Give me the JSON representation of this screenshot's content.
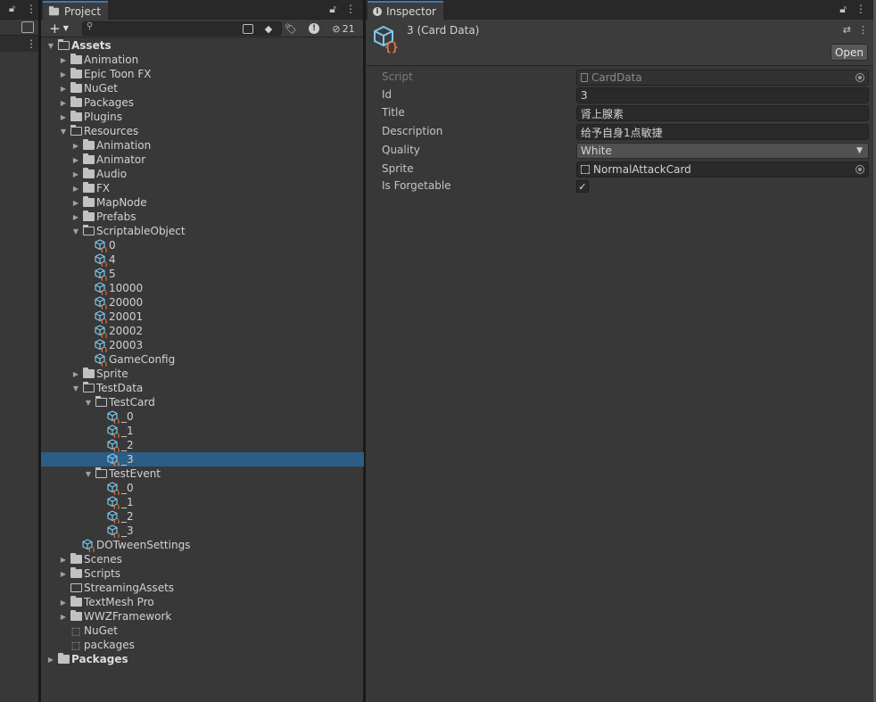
{
  "project": {
    "tab_label": "Project",
    "hidden_count": "21",
    "tree": [
      {
        "label": "Assets",
        "depth": 0,
        "kind": "folder-open",
        "arrow": "down",
        "bold": true
      },
      {
        "label": "Animation",
        "depth": 1,
        "kind": "folder",
        "arrow": "right"
      },
      {
        "label": "Epic Toon FX",
        "depth": 1,
        "kind": "folder",
        "arrow": "right"
      },
      {
        "label": "NuGet",
        "depth": 1,
        "kind": "folder",
        "arrow": "right"
      },
      {
        "label": "Packages",
        "depth": 1,
        "kind": "folder",
        "arrow": "right"
      },
      {
        "label": "Plugins",
        "depth": 1,
        "kind": "folder",
        "arrow": "right"
      },
      {
        "label": "Resources",
        "depth": 1,
        "kind": "folder-open",
        "arrow": "down"
      },
      {
        "label": "Animation",
        "depth": 2,
        "kind": "folder",
        "arrow": "right"
      },
      {
        "label": "Animator",
        "depth": 2,
        "kind": "folder",
        "arrow": "right"
      },
      {
        "label": "Audio",
        "depth": 2,
        "kind": "folder",
        "arrow": "right"
      },
      {
        "label": "FX",
        "depth": 2,
        "kind": "folder",
        "arrow": "right"
      },
      {
        "label": "MapNode",
        "depth": 2,
        "kind": "folder",
        "arrow": "right"
      },
      {
        "label": "Prefabs",
        "depth": 2,
        "kind": "folder",
        "arrow": "right"
      },
      {
        "label": "ScriptableObject",
        "depth": 2,
        "kind": "folder-open",
        "arrow": "down"
      },
      {
        "label": "0",
        "depth": 3,
        "kind": "asset"
      },
      {
        "label": "4",
        "depth": 3,
        "kind": "asset"
      },
      {
        "label": "5",
        "depth": 3,
        "kind": "asset"
      },
      {
        "label": "10000",
        "depth": 3,
        "kind": "asset"
      },
      {
        "label": "20000",
        "depth": 3,
        "kind": "asset"
      },
      {
        "label": "20001",
        "depth": 3,
        "kind": "asset"
      },
      {
        "label": "20002",
        "depth": 3,
        "kind": "asset"
      },
      {
        "label": "20003",
        "depth": 3,
        "kind": "asset"
      },
      {
        "label": "GameConfig",
        "depth": 3,
        "kind": "asset"
      },
      {
        "label": "Sprite",
        "depth": 2,
        "kind": "folder",
        "arrow": "right"
      },
      {
        "label": "TestData",
        "depth": 2,
        "kind": "folder-open",
        "arrow": "down"
      },
      {
        "label": "TestCard",
        "depth": 3,
        "kind": "folder-open",
        "arrow": "down"
      },
      {
        "label": "_0",
        "depth": 4,
        "kind": "asset"
      },
      {
        "label": "_1",
        "depth": 4,
        "kind": "asset"
      },
      {
        "label": "_2",
        "depth": 4,
        "kind": "asset"
      },
      {
        "label": "_3",
        "depth": 4,
        "kind": "asset",
        "selected": true
      },
      {
        "label": "TestEvent",
        "depth": 3,
        "kind": "folder-open",
        "arrow": "down"
      },
      {
        "label": "_0",
        "depth": 4,
        "kind": "asset"
      },
      {
        "label": "_1",
        "depth": 4,
        "kind": "asset"
      },
      {
        "label": "_2",
        "depth": 4,
        "kind": "asset"
      },
      {
        "label": "_3",
        "depth": 4,
        "kind": "asset"
      },
      {
        "label": "DOTweenSettings",
        "depth": 2,
        "kind": "asset"
      },
      {
        "label": "Scenes",
        "depth": 1,
        "kind": "folder",
        "arrow": "right"
      },
      {
        "label": "Scripts",
        "depth": 1,
        "kind": "folder",
        "arrow": "right"
      },
      {
        "label": "StreamingAssets",
        "depth": 1,
        "kind": "folder-empty"
      },
      {
        "label": "TextMesh Pro",
        "depth": 1,
        "kind": "folder",
        "arrow": "right"
      },
      {
        "label": "WWZFramework",
        "depth": 1,
        "kind": "folder",
        "arrow": "right"
      },
      {
        "label": "NuGet",
        "depth": 1,
        "kind": "puzzle"
      },
      {
        "label": "packages",
        "depth": 1,
        "kind": "puzzle"
      },
      {
        "label": "Packages",
        "depth": 0,
        "kind": "folder",
        "arrow": "right",
        "bold": true
      }
    ]
  },
  "inspector": {
    "tab_label": "Inspector",
    "title": "3 (Card Data)",
    "open_label": "Open",
    "props": {
      "script_label": "Script",
      "script_value": "CardData",
      "id_label": "Id",
      "id_value": "3",
      "title_label": "Title",
      "title_value": "肾上腺素",
      "description_label": "Description",
      "description_value": "给予自身1点敏捷",
      "quality_label": "Quality",
      "quality_value": "White",
      "sprite_label": "Sprite",
      "sprite_value": "NormalAttackCard",
      "forgetable_label": "Is Forgetable",
      "forgetable_checked": true,
      "checkmark": "✓"
    }
  },
  "colors": {
    "selection": "#2c5d87",
    "tab_accent": "#3a79bb",
    "asset_cube": "#7ec8ea",
    "asset_braces": "#e8763a"
  }
}
